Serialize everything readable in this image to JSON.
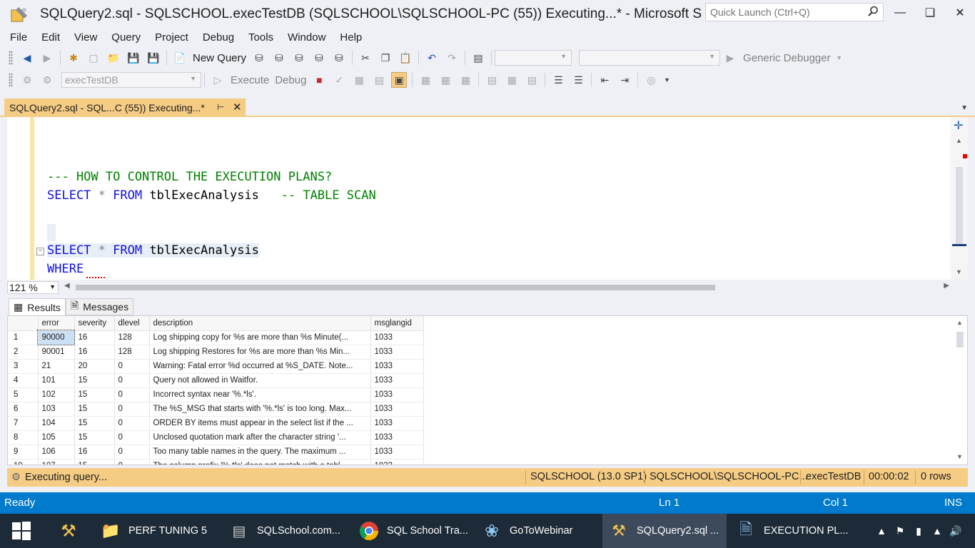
{
  "window": {
    "title": "SQLQuery2.sql - SQLSCHOOL.execTestDB (SQLSCHOOL\\SQLSCHOOL-PC (55)) Executing...* - Microsoft SQL Se...",
    "quick_launch_placeholder": "Quick Launch (Ctrl+Q)"
  },
  "menu": [
    "File",
    "Edit",
    "View",
    "Query",
    "Project",
    "Debug",
    "Tools",
    "Window",
    "Help"
  ],
  "toolbar1": {
    "new_query": "New Query",
    "debugger": "Generic Debugger"
  },
  "toolbar2": {
    "database": "execTestDB",
    "execute": "Execute",
    "debug": "Debug"
  },
  "doc_tab": {
    "label": "SQLQuery2.sql - SQL...C (55)) Executing...*"
  },
  "editor": {
    "line1_comment": "--- HOW TO CONTROL THE EXECUTION PLANS?",
    "line2_kw1": "SELECT",
    "line2_star": "*",
    "line2_kw2": "FROM",
    "line2_table": "tblExecAnalysis",
    "line2_comment": "-- TABLE SCAN",
    "line3_kw1": "SELECT",
    "line3_star": "*",
    "line3_kw2": "FROM",
    "line3_table": "tblExecAnalysis",
    "line4_kw": "WHERE",
    "zoom": "121 %"
  },
  "results": {
    "tab_results": "Results",
    "tab_messages": "Messages",
    "columns": [
      "error",
      "severity",
      "dlevel",
      "description",
      "msglangid"
    ],
    "rows": [
      [
        "1",
        "90000",
        "16",
        "128",
        "Log shipping copy for %s are more than %s Minute(...",
        "1033"
      ],
      [
        "2",
        "90001",
        "16",
        "128",
        "Log shipping Restores for %s are more than %s Min...",
        "1033"
      ],
      [
        "3",
        "21",
        "20",
        "0",
        "Warning: Fatal error %d occurred at %S_DATE. Note...",
        "1033"
      ],
      [
        "4",
        "101",
        "15",
        "0",
        "Query not allowed in Waitfor.",
        "1033"
      ],
      [
        "5",
        "102",
        "15",
        "0",
        "Incorrect syntax near '%.*ls'.",
        "1033"
      ],
      [
        "6",
        "103",
        "15",
        "0",
        "The %S_MSG that starts with '%.*ls' is too long. Max...",
        "1033"
      ],
      [
        "7",
        "104",
        "15",
        "0",
        "ORDER BY items must appear in the select list if the ...",
        "1033"
      ],
      [
        "8",
        "105",
        "15",
        "0",
        "Unclosed quotation mark after the character string '...",
        "1033"
      ],
      [
        "9",
        "106",
        "16",
        "0",
        "Too many table names in the query. The maximum ...",
        "1033"
      ],
      [
        "10",
        "107",
        "15",
        "0",
        "The column prefix '%.*ls' does not match with a tabl...",
        "1033"
      ]
    ]
  },
  "exec_bar": {
    "status": "Executing query...",
    "server": "SQLSCHOOL (13.0 SP1)",
    "user": "SQLSCHOOL\\SQLSCHOOL-PC...",
    "database": "execTestDB",
    "elapsed": "00:00:02",
    "rows": "0 rows"
  },
  "statusbar": {
    "state": "Ready",
    "line": "Ln 1",
    "col": "Col 1",
    "mode": "INS"
  },
  "taskbar": {
    "items": [
      "PERF TUNING 5",
      "SQLSchool.com...",
      "SQL School Tra...",
      "GoToWebinar",
      "SQLQuery2.sql ...",
      "EXECUTION PL..."
    ]
  },
  "colors": {
    "accent_tab": "#f5cc84",
    "statusbar": "#007acc",
    "keyword": "#1010e0",
    "comment": "#008000"
  }
}
